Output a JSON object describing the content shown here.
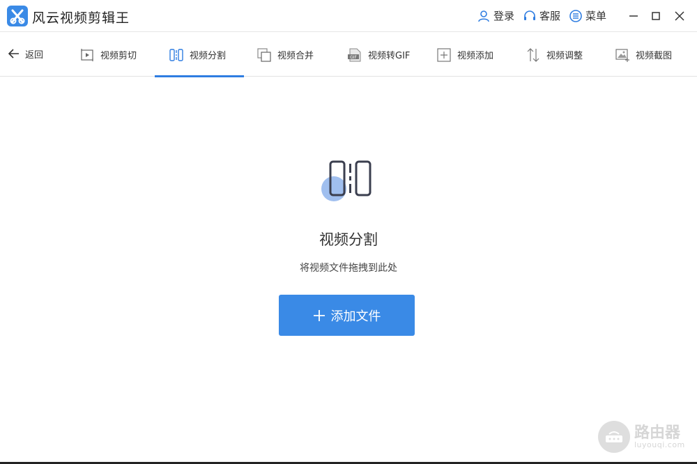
{
  "app": {
    "title": "风云视频剪辑王"
  },
  "top_actions": {
    "login": "登录",
    "service": "客服",
    "menu": "菜单"
  },
  "toolbar": {
    "back": "返回",
    "tabs": [
      {
        "label": "视频剪切",
        "icon": "video-cut-icon"
      },
      {
        "label": "视频分割",
        "icon": "video-split-icon",
        "active": true
      },
      {
        "label": "视频合并",
        "icon": "video-merge-icon"
      },
      {
        "label": "视频转GIF",
        "icon": "gif-icon"
      },
      {
        "label": "视频添加",
        "icon": "video-add-icon"
      },
      {
        "label": "视频调整",
        "icon": "video-adjust-icon"
      },
      {
        "label": "视频截图",
        "icon": "video-screenshot-icon"
      }
    ]
  },
  "main": {
    "title": "视频分割",
    "subtitle": "将视频文件拖拽到此处",
    "add_button": "添加文件"
  },
  "watermark": {
    "main": "路由器",
    "sub": "luyouqi.com"
  },
  "colors": {
    "accent": "#2f7de1",
    "button": "#3a8ae6",
    "icon_dark": "#3b3f4f",
    "icon_circle": "#8fb4ec"
  }
}
